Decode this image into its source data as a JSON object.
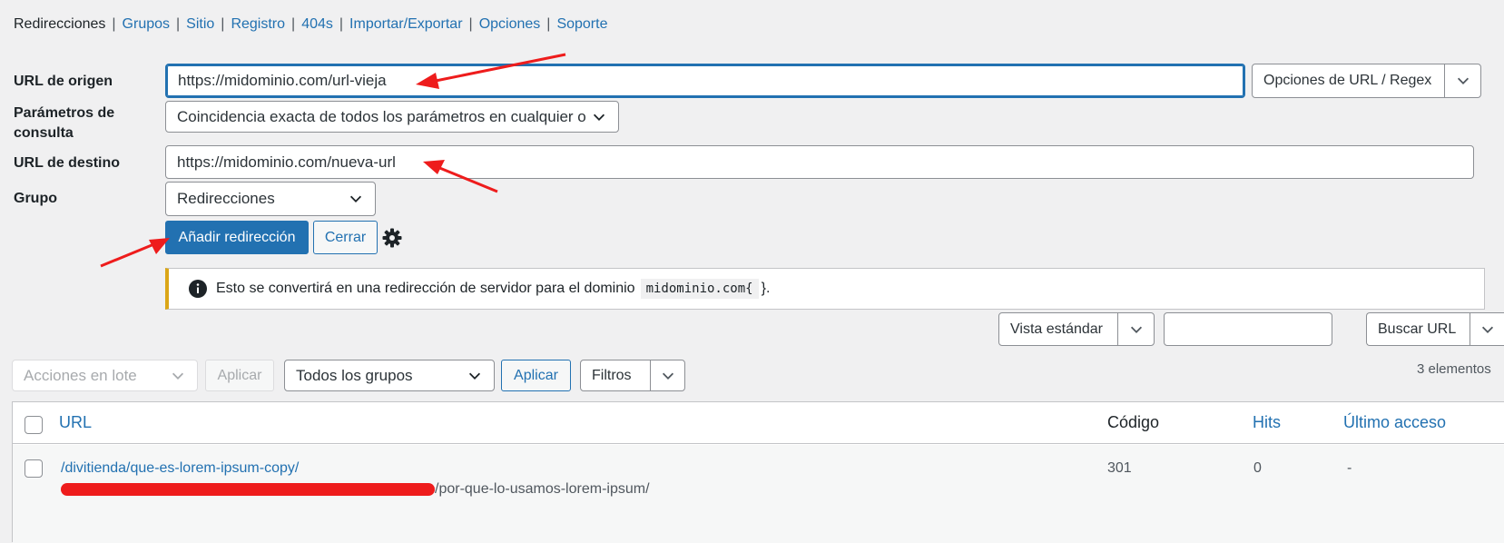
{
  "nav": {
    "current": "Redirecciones",
    "links": [
      "Grupos",
      "Sitio",
      "Registro",
      "404s",
      "Importar/Exportar",
      "Opciones",
      "Soporte"
    ]
  },
  "form": {
    "source_label": "URL de origen",
    "source_value": "https://midominio.com/url-vieja",
    "url_options": "Opciones de URL / Regex",
    "query_label_1": "Parámetros de",
    "query_label_2": "consulta",
    "query_value": "Coincidencia exacta de todos los parámetros en cualquier o",
    "target_label": "URL de destino",
    "target_value": "https://midominio.com/nueva-url",
    "group_label": "Grupo",
    "group_value": "Redirecciones",
    "add_button": "Añadir redirección",
    "close_button": "Cerrar"
  },
  "notice": {
    "text": "Esto se convertirá en una redirección de servidor para el dominio",
    "domain": "midominio.com{",
    "suffix": "}."
  },
  "toolbar": {
    "view_select": "Vista estándar",
    "search_value": "",
    "search_select": "Buscar URL",
    "bulk_actions": "Acciones en lote",
    "apply1": "Aplicar",
    "groups_select": "Todos los grupos",
    "apply2": "Aplicar",
    "filters": "Filtros",
    "count": "3 elementos"
  },
  "table": {
    "headers": {
      "url": "URL",
      "code": "Código",
      "hits": "Hits",
      "last": "Último acceso"
    },
    "rows": [
      {
        "source": "/divitienda/que-es-lorem-ipsum-copy/",
        "target_suffix": "/por-que-lo-usamos-lorem-ipsum/",
        "code": "301",
        "hits": "0",
        "last": "-"
      }
    ]
  },
  "colors": {
    "accent": "#2271b1",
    "annotation": "#ee1c1c",
    "notice_border": "#dba617"
  }
}
